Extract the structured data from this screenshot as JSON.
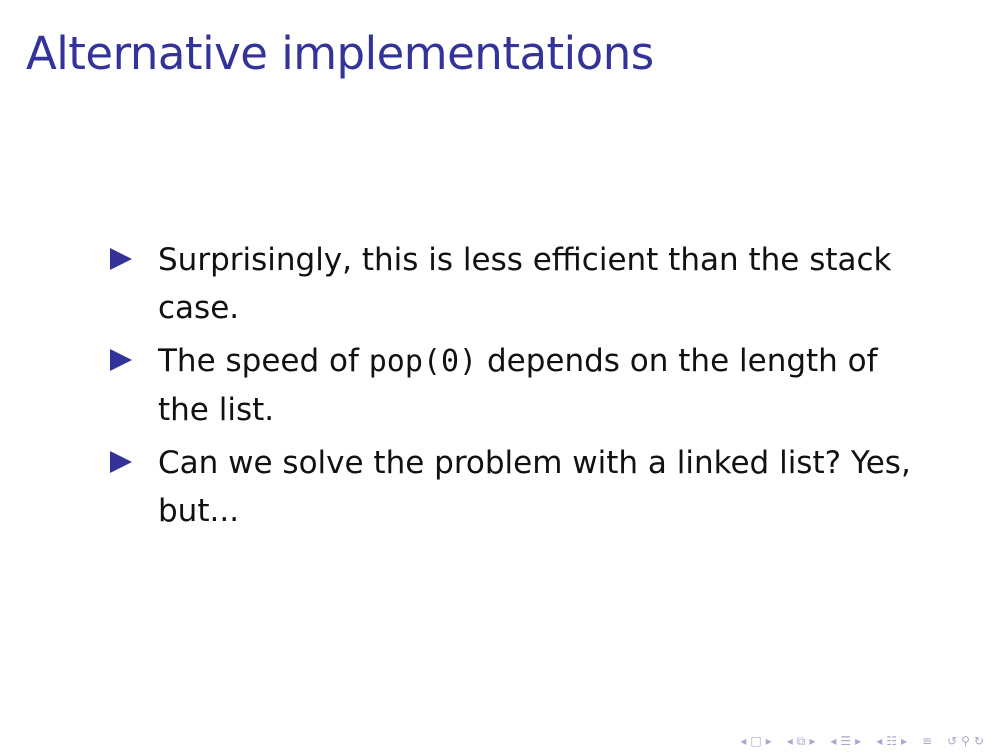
{
  "slide": {
    "title": "Alternative implementations",
    "items": [
      {
        "text": "Surprisingly, this is less efficient than the stack case."
      },
      {
        "before": "The speed of ",
        "code": "pop(0)",
        "after": " depends on the length of the list."
      },
      {
        "text": "Can we solve the problem with a linked list? Yes, but..."
      }
    ]
  },
  "navigation": {
    "icons": [
      "nav-prev-icon",
      "nav-frame-icon",
      "nav-next-icon",
      "nav-subsection-icon",
      "nav-section-icon",
      "nav-align-icon",
      "nav-search-icon"
    ]
  },
  "colors": {
    "title": "#33339a",
    "bullet": "#33339a",
    "text": "#111111",
    "nav": "#a8a8d0"
  }
}
